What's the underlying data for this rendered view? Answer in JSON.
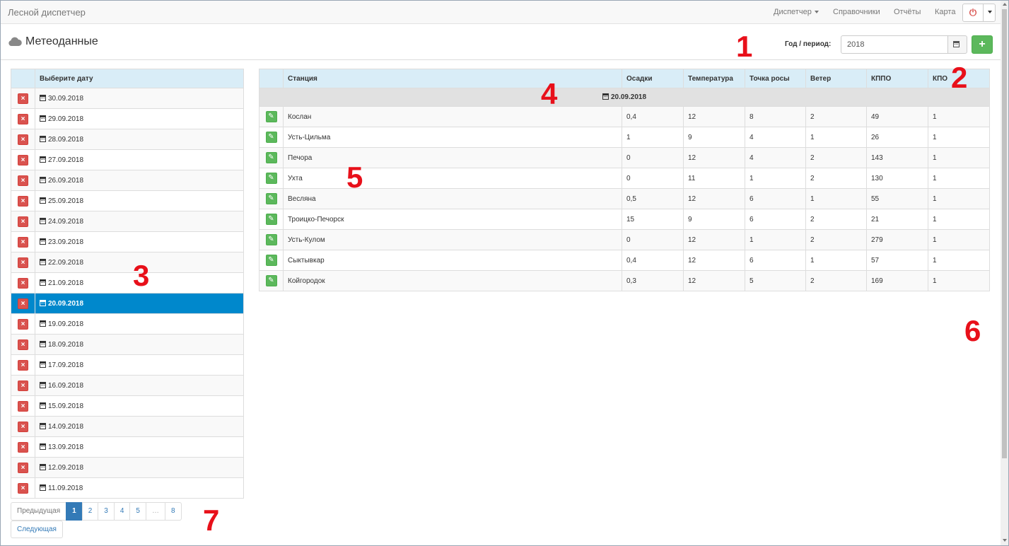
{
  "navbar": {
    "brand": "Лесной диспетчер",
    "items": [
      "Диспетчер",
      "Справочники",
      "Отчёты",
      "Карта"
    ],
    "power_icon": "power-icon"
  },
  "header": {
    "title": "Метеоданные",
    "icon": "cloud-icon",
    "period_label": "Год / период:",
    "period_value": "2018"
  },
  "dates_table": {
    "header": "Выберите дату",
    "selected_index": 10,
    "dates": [
      "30.09.2018",
      "29.09.2018",
      "28.09.2018",
      "27.09.2018",
      "26.09.2018",
      "25.09.2018",
      "24.09.2018",
      "23.09.2018",
      "22.09.2018",
      "21.09.2018",
      "20.09.2018",
      "19.09.2018",
      "18.09.2018",
      "17.09.2018",
      "16.09.2018",
      "15.09.2018",
      "14.09.2018",
      "13.09.2018",
      "12.09.2018",
      "11.09.2018"
    ]
  },
  "stations_table": {
    "columns": [
      "Станция",
      "Осадки",
      "Температура",
      "Точка росы",
      "Ветер",
      "КППО",
      "КПО"
    ],
    "group_date": "20.09.2018",
    "rows": [
      [
        "Кослан",
        "0,4",
        "12",
        "8",
        "2",
        "49",
        "1"
      ],
      [
        "Усть-Цильма",
        "1",
        "9",
        "4",
        "1",
        "26",
        "1"
      ],
      [
        "Печора",
        "0",
        "12",
        "4",
        "2",
        "143",
        "1"
      ],
      [
        "Ухта",
        "0",
        "11",
        "1",
        "2",
        "130",
        "1"
      ],
      [
        "Весляна",
        "0,5",
        "12",
        "6",
        "1",
        "55",
        "1"
      ],
      [
        "Троицко-Печорск",
        "15",
        "9",
        "6",
        "2",
        "21",
        "1"
      ],
      [
        "Усть-Кулом",
        "0",
        "12",
        "1",
        "2",
        "279",
        "1"
      ],
      [
        "Сыктывкар",
        "0,4",
        "12",
        "6",
        "1",
        "57",
        "1"
      ],
      [
        "Койгородок",
        "0,3",
        "12",
        "5",
        "2",
        "169",
        "1"
      ]
    ]
  },
  "pagination": {
    "prev": "Предыдущая",
    "pages": [
      "1",
      "2",
      "3",
      "4",
      "5",
      "…",
      "8"
    ],
    "current": "1",
    "next": "Следующая"
  },
  "annotations": [
    "1",
    "2",
    "3",
    "4",
    "5",
    "6",
    "7"
  ],
  "colors": {
    "selected_row": "#0088cc",
    "table_header": "#d9edf7",
    "delete_button": "#d9534f",
    "edit_button": "#5cb85c",
    "annotation": "#e8101a"
  }
}
